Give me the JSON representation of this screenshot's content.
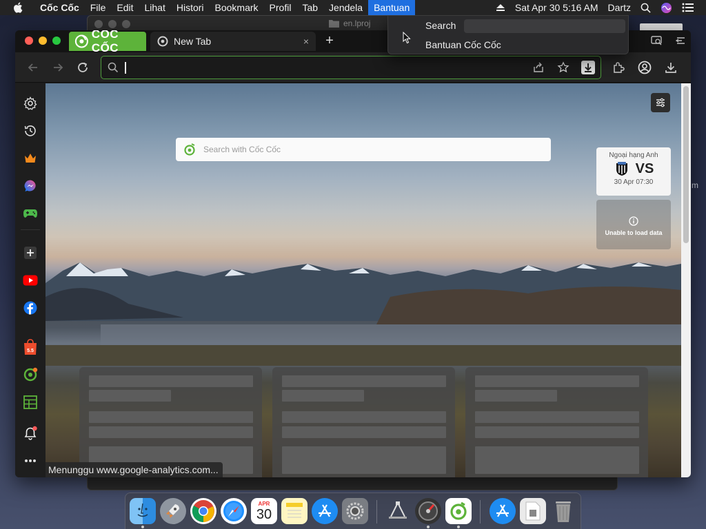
{
  "menubar": {
    "app_name": "Cốc Cốc",
    "items": [
      "File",
      "Edit",
      "Lihat",
      "Histori",
      "Bookmark",
      "Profil",
      "Tab",
      "Jendela",
      "Bantuan"
    ],
    "clock": "Sat Apr 30  5:16 AM",
    "user": "Dartz"
  },
  "back_window": {
    "title": "en.lproj"
  },
  "browser": {
    "brand_tab_label": "CỐC CỐC",
    "active_tab_label": "New Tab",
    "active_tab_close": "×",
    "new_tab_glyph": "+",
    "address_bar": {
      "value": "",
      "placeholder": ""
    }
  },
  "newtab": {
    "search_placeholder": "Search with Cốc Cốc",
    "match_card": {
      "league": "Ngoại hạng Anh",
      "vs": "VS",
      "date": "30 Apr 07:30"
    },
    "data_card": {
      "message": "Unable to load data"
    },
    "status_text": "Menunggu www.google-analytics.com..."
  },
  "help_menu": {
    "search_label": "Search",
    "search_value": "",
    "items": [
      "Bantuan Cốc Cốc"
    ]
  },
  "dock": {
    "calendar_month": "APR",
    "calendar_day": "30"
  },
  "desktop": {
    "edge_letter": "m"
  },
  "colors": {
    "brand_green": "#5db33a",
    "menu_highlight": "#1f6fe0",
    "omnibox_border": "#4e9b3c"
  }
}
